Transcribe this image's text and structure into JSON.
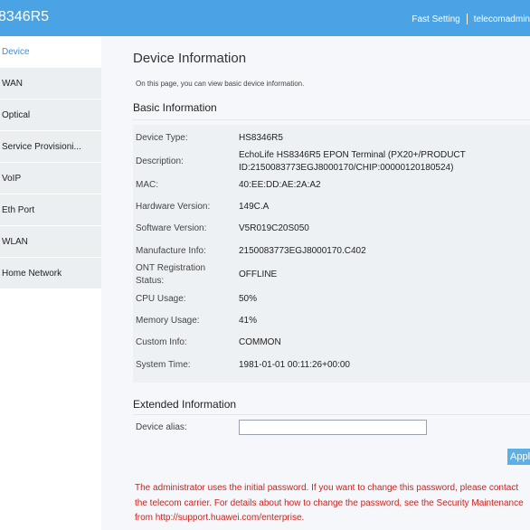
{
  "header": {
    "title": "8346R5",
    "fast_setting": "Fast Setting",
    "user": "telecomadmin"
  },
  "sidebar": {
    "items": [
      {
        "label": "Device",
        "active": true
      },
      {
        "label": "WAN"
      },
      {
        "label": "Optical"
      },
      {
        "label": "Service Provisioni..."
      },
      {
        "label": "VoIP"
      },
      {
        "label": "Eth Port"
      },
      {
        "label": "WLAN"
      },
      {
        "label": "Home Network"
      }
    ]
  },
  "main": {
    "title": "Device Information",
    "description": "On this page, you can view basic device information.",
    "basic_title": "Basic Information",
    "rows": [
      {
        "label": "Device Type:",
        "value": "HS8346R5"
      },
      {
        "label": "Description:",
        "value_line1": "EchoLife HS8346R5 EPON Terminal (PX20+/PRODUCT",
        "value_line2": "ID:2150083773EGJ8000170/CHIP:00000120180524)"
      },
      {
        "label": "MAC:",
        "value": "40:EE:DD:AE:2A:A2"
      },
      {
        "label": "Hardware Version:",
        "value": "149C.A"
      },
      {
        "label": "Software Version:",
        "value": "V5R019C20S050"
      },
      {
        "label": "Manufacture Info:",
        "value": "2150083773EGJ8000170.C402"
      },
      {
        "label_line1": "ONT Registration",
        "label_line2": "Status:",
        "value": "OFFLINE"
      },
      {
        "label": "CPU Usage:",
        "value": "50%"
      },
      {
        "label": "Memory Usage:",
        "value": "41%"
      },
      {
        "label": "Custom Info:",
        "value": "COMMON"
      },
      {
        "label": "System Time:",
        "value": "1981-01-01 00:11:26+00:00"
      }
    ],
    "extended_title": "Extended Information",
    "alias_label": "Device alias:",
    "alias_value": "",
    "apply_label": "Apply",
    "notice": {
      "line1": "The administrator uses the initial password. If you want to change this password, please contact",
      "line2": "the telecom carrier. For details about how to change the password, see the Security Maintenance",
      "line3": "from http://support.huawei.com/enterprise."
    }
  },
  "colors": {
    "header_bg": "#4aa3e4",
    "active_nav": "#3b8fd8",
    "notice_text": "#d0211a",
    "apply_bg": "#5db0e6"
  }
}
